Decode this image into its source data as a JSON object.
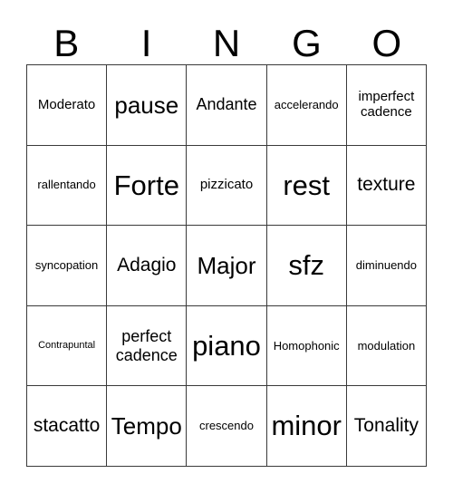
{
  "card": {
    "title": "BINGO",
    "header_letters": [
      "B",
      "I",
      "N",
      "G",
      "O"
    ],
    "grid_size": "5x5",
    "colors": {
      "text": "#000000",
      "background": "#ffffff",
      "border": "#3a3a3a"
    },
    "rows": [
      [
        {
          "label": "Moderato",
          "size": "s"
        },
        {
          "label": "pause",
          "size": "xl"
        },
        {
          "label": "Andante",
          "size": "m"
        },
        {
          "label": "accelerando",
          "size": "xs"
        },
        {
          "label": "imperfect cadence",
          "size": "s",
          "lines": 2
        }
      ],
      [
        {
          "label": "rallentando",
          "size": "xs"
        },
        {
          "label": "Forte",
          "size": "xxl"
        },
        {
          "label": "pizzicato",
          "size": "s"
        },
        {
          "label": "rest",
          "size": "xxl"
        },
        {
          "label": "texture",
          "size": "l"
        }
      ],
      [
        {
          "label": "syncopation",
          "size": "xs"
        },
        {
          "label": "Adagio",
          "size": "l"
        },
        {
          "label": "Major",
          "size": "xl"
        },
        {
          "label": "sfz",
          "size": "xxl"
        },
        {
          "label": "diminuendo",
          "size": "xs"
        }
      ],
      [
        {
          "label": "Contrapuntal",
          "size": "xxs"
        },
        {
          "label": "perfect cadence",
          "size": "m",
          "lines": 2
        },
        {
          "label": "piano",
          "size": "xxl"
        },
        {
          "label": "Homophonic",
          "size": "xs"
        },
        {
          "label": "modulation",
          "size": "xs"
        }
      ],
      [
        {
          "label": "stacatto",
          "size": "l"
        },
        {
          "label": "Tempo",
          "size": "xl"
        },
        {
          "label": "crescendo",
          "size": "xs"
        },
        {
          "label": "minor",
          "size": "xxl"
        },
        {
          "label": "Tonality",
          "size": "l"
        }
      ]
    ]
  }
}
